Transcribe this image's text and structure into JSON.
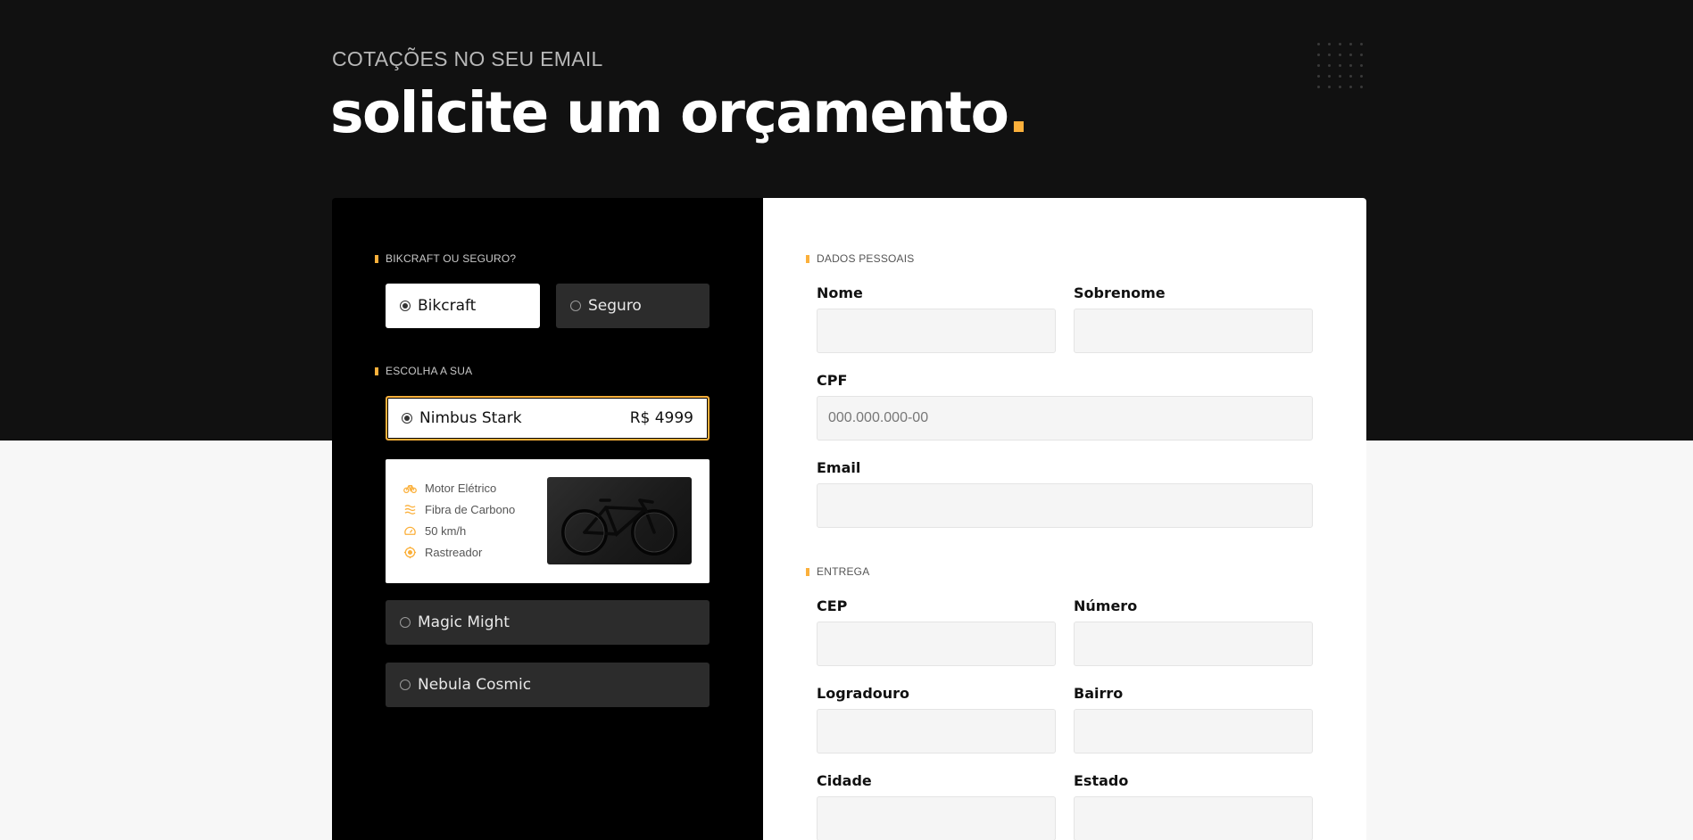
{
  "header": {
    "eyebrow": "COTAÇÕES NO SEU EMAIL",
    "title": "solicite um orçamento",
    "title_dot": ".",
    "accent_color": "#fbb03b"
  },
  "left": {
    "type_section": {
      "label": "BIKCRAFT OU SEGURO?",
      "options": [
        {
          "label": "Bikcraft",
          "selected": true
        },
        {
          "label": "Seguro",
          "selected": false
        }
      ]
    },
    "choose_section": {
      "label": "ESCOLHA A SUA",
      "products": [
        {
          "name": "Nimbus Stark",
          "price": "R$ 4999",
          "selected": true
        },
        {
          "name": "Magic Might",
          "selected": false
        },
        {
          "name": "Nebula Cosmic",
          "selected": false
        }
      ]
    },
    "product_card": {
      "features": [
        {
          "icon": "electric-bike-icon",
          "label": "Motor Elétrico"
        },
        {
          "icon": "carbon-fiber-icon",
          "label": "Fibra de Carbono"
        },
        {
          "icon": "speedometer-icon",
          "label": "50 km/h"
        },
        {
          "icon": "tracker-icon",
          "label": "Rastreador"
        }
      ]
    }
  },
  "right": {
    "personal": {
      "label": "DADOS PESSOAIS",
      "nome": {
        "label": "Nome",
        "value": "",
        "placeholder": ""
      },
      "sobrenome": {
        "label": "Sobrenome",
        "value": "",
        "placeholder": ""
      },
      "cpf": {
        "label": "CPF",
        "value": "",
        "placeholder": "000.000.000-00"
      },
      "email": {
        "label": "Email",
        "value": "",
        "placeholder": ""
      }
    },
    "delivery": {
      "label": "ENTREGA",
      "cep": {
        "label": "CEP",
        "value": "",
        "placeholder": ""
      },
      "numero": {
        "label": "Número",
        "value": "",
        "placeholder": ""
      },
      "logradouro": {
        "label": "Logradouro",
        "value": "",
        "placeholder": ""
      },
      "bairro": {
        "label": "Bairro",
        "value": "",
        "placeholder": ""
      },
      "cidade": {
        "label": "Cidade",
        "value": "",
        "placeholder": ""
      },
      "estado": {
        "label": "Estado",
        "value": "",
        "placeholder": ""
      }
    }
  }
}
